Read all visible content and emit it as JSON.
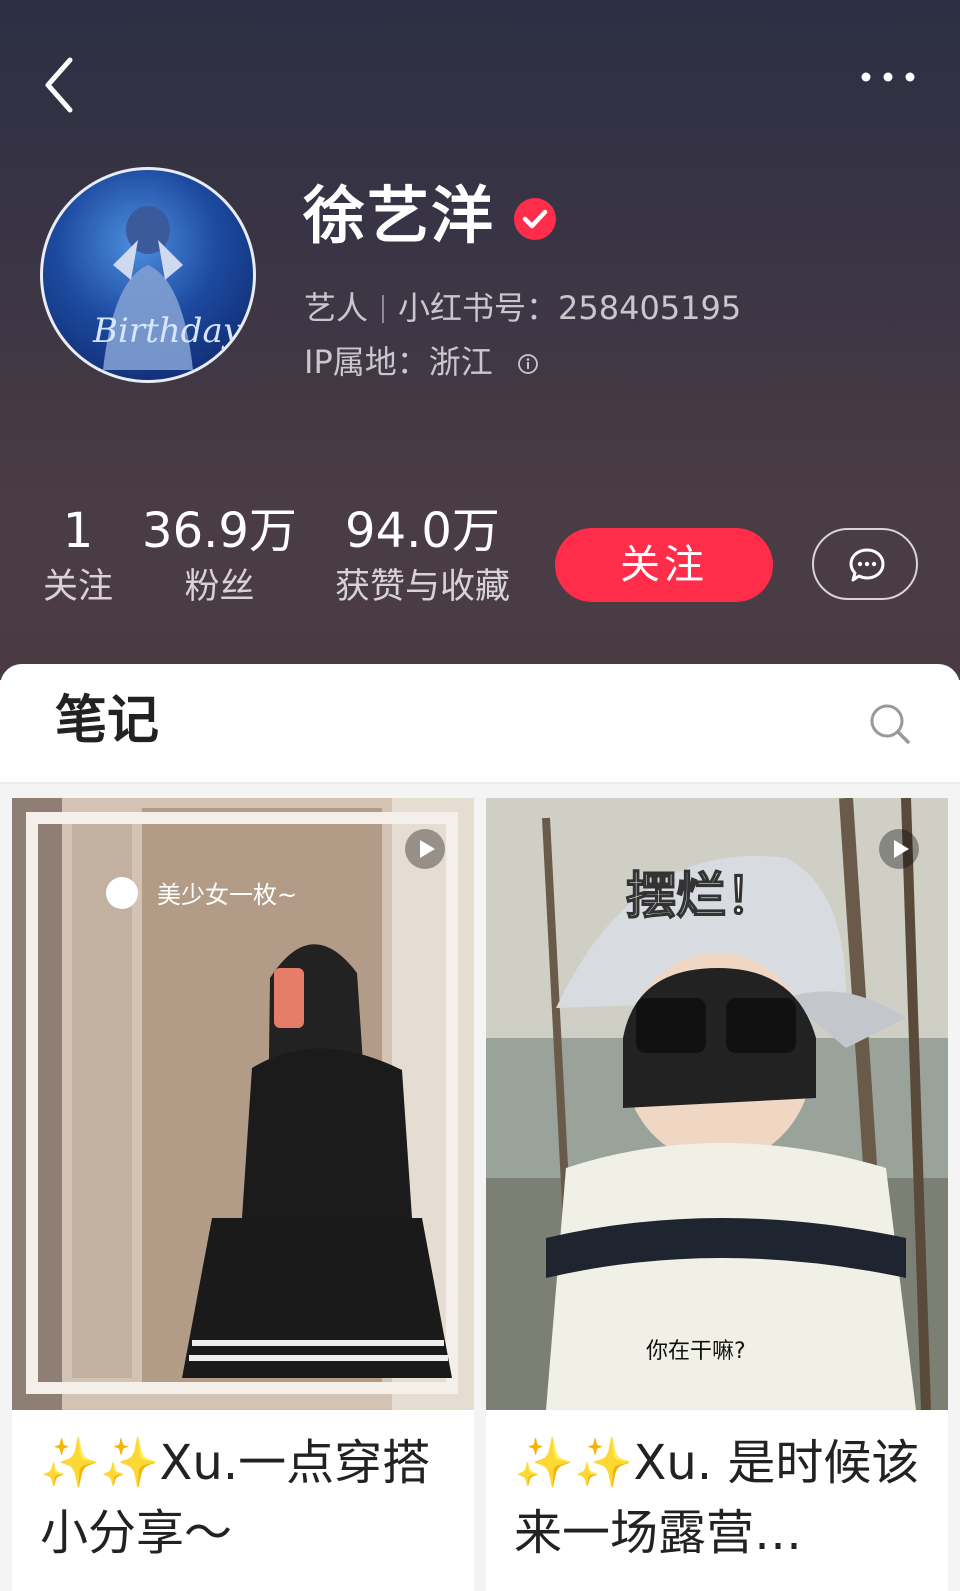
{
  "header": {
    "back_icon": "chevron-left-icon",
    "more_icon": "more-horizontal-icon",
    "name": "徐艺洋",
    "verified_icon": "verified-badge-icon",
    "role": "艺人",
    "id_label": "小红书号：258405195",
    "ip_label": "IP属地：浙江",
    "info_icon": "info-circle-icon",
    "avatar_text": "Birthday"
  },
  "stats": [
    {
      "value": "1",
      "label": "关注"
    },
    {
      "value": "36.9万",
      "label": "粉丝"
    },
    {
      "value": "94.0万",
      "label": "获赞与收藏"
    }
  ],
  "actions": {
    "follow_label": "关注",
    "message_icon": "chat-bubble-icon"
  },
  "tabs": {
    "notes_label": "笔记",
    "search_icon": "search-icon"
  },
  "notes": [
    {
      "caption": "美少女一枚~",
      "title": "✨✨Xu.一点穿搭小分享～",
      "type": "video"
    },
    {
      "caption": "摆烂！",
      "subcaption": "你在干嘛?",
      "title": "✨✨Xu. 是时候该来一场露营…",
      "type": "video"
    }
  ],
  "colors": {
    "accent": "#ff2d4a",
    "header_top": "#2c2f44",
    "header_bottom": "#4a3b43"
  }
}
